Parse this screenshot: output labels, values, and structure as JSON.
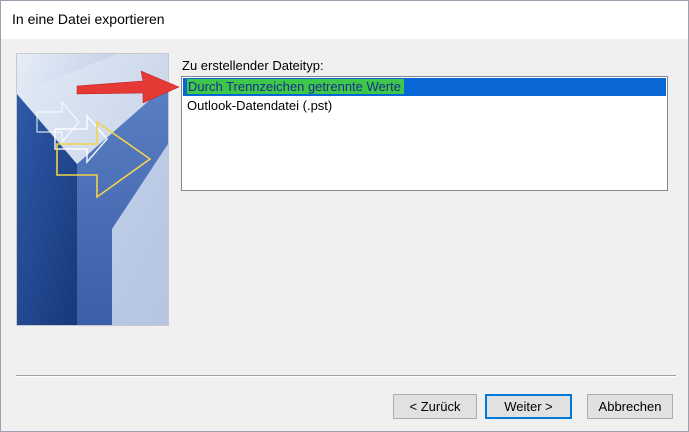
{
  "window": {
    "title": "In eine Datei exportieren"
  },
  "main": {
    "list_label": "Zu erstellender Dateityp:",
    "file_types": [
      {
        "label": "Durch Trennzeichen getrennte Werte",
        "selected": true
      },
      {
        "label": "Outlook-Datendatei (.pst)",
        "selected": false
      }
    ]
  },
  "buttons": {
    "back": "< Zurück",
    "next": "Weiter >",
    "cancel": "Abbrechen"
  },
  "colors": {
    "selection": "#0a68d6",
    "highlight": "#3ec84a",
    "annotation_arrow": "#e53935",
    "default_button_border": "#0078d7"
  },
  "icons": {
    "art": "export-wizard-art",
    "annotation": "red-arrow-icon"
  }
}
